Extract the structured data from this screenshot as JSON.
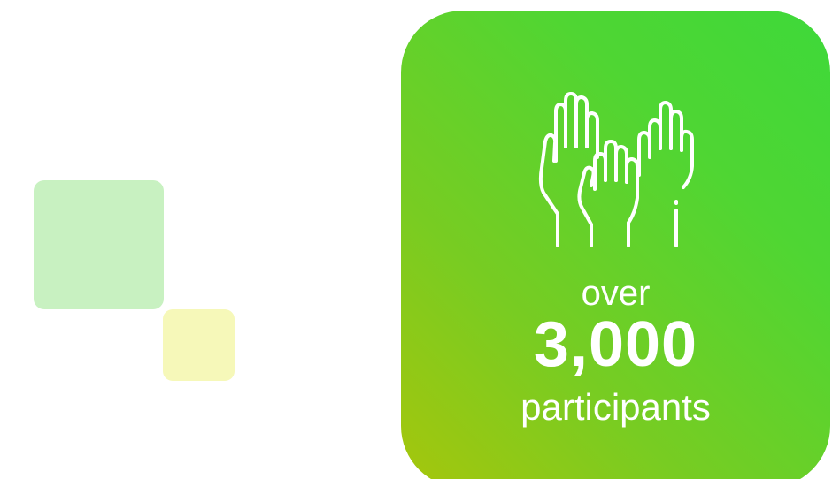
{
  "colors": {
    "background": "#ffffff",
    "card_gradient": [
      "#3ed83a",
      "#a6c60c"
    ],
    "deco_green": "#c8f1c1",
    "deco_yellow": "#f6f8b9",
    "text": "#ffffff"
  },
  "icon": "raised-hands-icon",
  "stat": {
    "prefix": "over",
    "number": "3,000",
    "unit": "participants"
  }
}
